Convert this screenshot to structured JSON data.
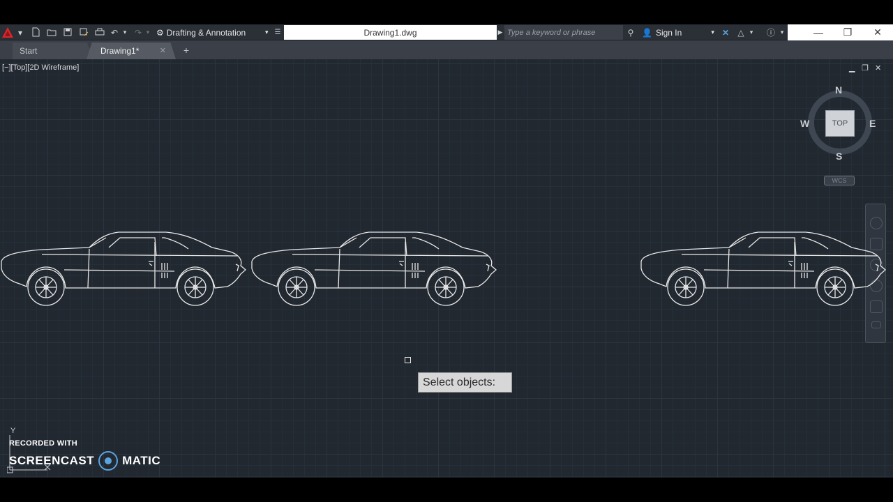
{
  "titlebar": {
    "workspace": "Drafting & Annotation",
    "file_title": "Drawing1.dwg",
    "search_placeholder": "Type a keyword or phrase",
    "signin": "Sign In"
  },
  "tabs": {
    "start": "Start",
    "active": "Drawing1*"
  },
  "viewport": {
    "label": "[−][Top][2D Wireframe]"
  },
  "viewcube": {
    "face": "TOP",
    "north": "N",
    "south": "S",
    "east": "E",
    "west": "W",
    "wcs": "WCS"
  },
  "command": {
    "prompt": "Select objects:"
  },
  "watermark": {
    "recorded": "RECORDED WITH",
    "left": "SCREENCAST",
    "right": "MATIC"
  },
  "ucs": {
    "y_label": "Y"
  },
  "colors": {
    "canvas": "#212830",
    "linework": "#e8e8e8",
    "accent": "#5aa4e0"
  }
}
